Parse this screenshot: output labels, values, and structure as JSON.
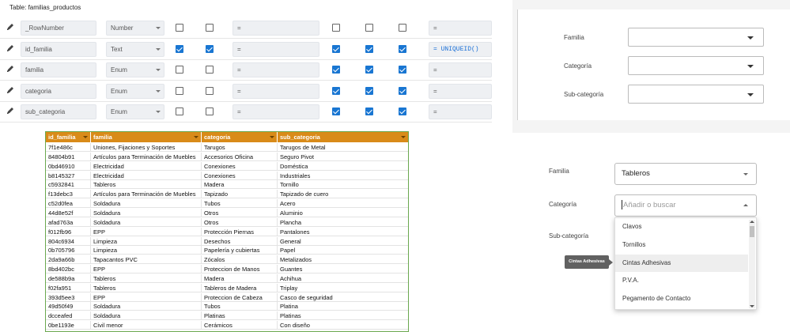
{
  "editor": {
    "title": "Table: familias_productos",
    "columns": [
      {
        "name": "_RowNumber",
        "type": "Number",
        "c1": false,
        "c2": false,
        "eq1": "=",
        "c3": false,
        "c4": false,
        "c5": false,
        "eq2": "=",
        "mono": false
      },
      {
        "name": "id_familia",
        "type": "Text",
        "c1": true,
        "c2": true,
        "eq1": "=",
        "c3": true,
        "c4": true,
        "c5": true,
        "eq2": "= UNIQUEID()",
        "mono": true
      },
      {
        "name": "familia",
        "type": "Enum",
        "c1": false,
        "c2": false,
        "eq1": "=",
        "c3": true,
        "c4": true,
        "c5": true,
        "eq2": "=",
        "mono": false
      },
      {
        "name": "categoria",
        "type": "Enum",
        "c1": false,
        "c2": false,
        "eq1": "=",
        "c3": true,
        "c4": true,
        "c5": true,
        "eq2": "=",
        "mono": false
      },
      {
        "name": "sub_categoria",
        "type": "Enum",
        "c1": false,
        "c2": false,
        "eq1": "=",
        "c3": true,
        "c4": true,
        "c5": true,
        "eq2": "=",
        "mono": false
      }
    ]
  },
  "form_top": {
    "fields": [
      {
        "label": "Familia"
      },
      {
        "label": "Categoría"
      },
      {
        "label": "Sub-categoría"
      }
    ]
  },
  "sheet": {
    "headers": [
      "id_familia",
      "familia",
      "categoria",
      "sub_categoria"
    ],
    "rows": [
      [
        "7f1e486c",
        "Uniones, Fijaciones y Soportes",
        "Tarugos",
        "Tarugos de Metal"
      ],
      [
        "84804b91",
        "Artículos para Terminación de Muebles",
        "Accesorios Oficina",
        "Seguro Pivot"
      ],
      [
        "0bd46910",
        "Electricidad",
        "Conexiones",
        "Doméstica"
      ],
      [
        "b8145327",
        "Electricidad",
        "Conexiones",
        "Industriales"
      ],
      [
        "c5932841",
        "Tableros",
        "Madera",
        "Tornillo"
      ],
      [
        "f13debc3",
        "Artículos para Terminación de Muebles",
        "Tapizado",
        "Tapizado de cuero"
      ],
      [
        "c52d0fea",
        "Soldadura",
        "Tubos",
        "Acero"
      ],
      [
        "44d8e52f",
        "Soldadura",
        "Otros",
        "Aluminio"
      ],
      [
        "afad763a",
        "Soldadura",
        "Otros",
        "Plancha"
      ],
      [
        "f012fb96",
        "EPP",
        "Protección Piernas",
        "Pantalones"
      ],
      [
        "804c6934",
        "Limpieza",
        "Desechos",
        "General"
      ],
      [
        "0b705796",
        "Limpieza",
        "Papelería y cubiertas",
        "Papel"
      ],
      [
        "2da9a66b",
        "Tapacantos PVC",
        "Zócalos",
        "Metalizados"
      ],
      [
        "8bd402bc",
        "EPP",
        "Proteccion de Manos",
        "Guantes"
      ],
      [
        "de588b9a",
        "Tableros",
        "Madera",
        "Achihua"
      ],
      [
        "f02fa951",
        "Tableros",
        "Tableros de Madera",
        "Triplay"
      ],
      [
        "393d5ee3",
        "EPP",
        "Proteccion de Cabeza",
        "Casco de seguridad"
      ],
      [
        "49d50f49",
        "Soldadura",
        "Tubos",
        "Platina"
      ],
      [
        "dcceafed",
        "Soldadura",
        "Platinas",
        "Platinas"
      ],
      [
        "0be1193e",
        "Civil menor",
        "Cerámicos",
        "Con diseño"
      ]
    ]
  },
  "form_bottom": {
    "familia_label": "Familia",
    "familia_value": "Tableros",
    "categoria_label": "Categoría",
    "categoria_placeholder": "Añadir o buscar",
    "subcategoria_label": "Sub-categoría",
    "options": [
      "Clavos",
      "Tornillos",
      "Cintas Adhesivas",
      "P.V.A.",
      "Pegamento de Contacto"
    ],
    "tooltip": "Cintas Adhesivas"
  },
  "colors": {
    "header_orange": "#d98b19",
    "sheet_border": "#6aa84f",
    "checkbox_blue": "#1976d2"
  }
}
